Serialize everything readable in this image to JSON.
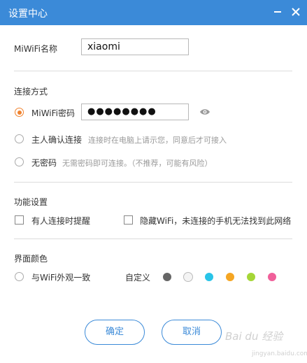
{
  "window": {
    "title": "设置中心"
  },
  "wifi_name": {
    "label": "MiWiFi名称",
    "value": "xiaomi"
  },
  "connection": {
    "section_title": "连接方式",
    "options": [
      {
        "label": "MiWiFi密码",
        "password": "●●●●●●●●",
        "selected": true
      },
      {
        "label": "主人确认连接",
        "hint": "连接时在电脑上请示您，同意后才可接入",
        "selected": false
      },
      {
        "label": "无密码",
        "hint": "无需密码即可连接。（不推荐，可能有风险）",
        "selected": false
      }
    ]
  },
  "features": {
    "section_title": "功能设置",
    "options": [
      {
        "label": "有人连接时提醒",
        "checked": false
      },
      {
        "label": "隐藏WiFi，未连接的手机无法找到此网络",
        "checked": false
      }
    ]
  },
  "appearance": {
    "section_title": "界面颜色",
    "match_label": "与WiFi外观一致",
    "custom_label": "自定义",
    "colors": [
      "#666666",
      "#f4f4f4",
      "#29c4e8",
      "#f5a623",
      "#a5d637",
      "#f0609a"
    ]
  },
  "buttons": {
    "ok": "确定",
    "cancel": "取消"
  },
  "watermark": {
    "brand": "Bai du 经验",
    "url": "jingyan.baidu.com"
  },
  "accent_color": "#3b8ad8",
  "selection_color": "#f0822d"
}
